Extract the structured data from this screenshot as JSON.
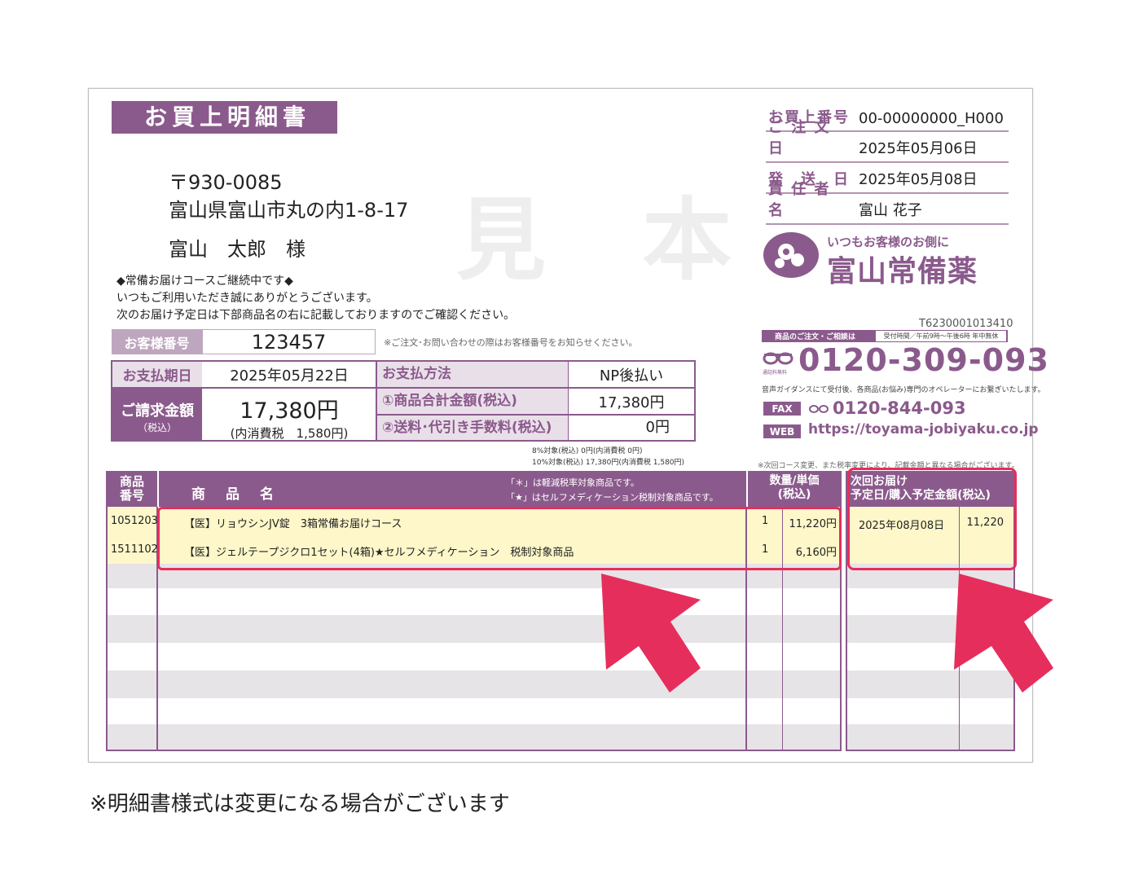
{
  "doc": {
    "title": "お買上明細書",
    "watermark": "見 本",
    "postal": "〒930-0085",
    "address": "富山県富山市丸の内1-8-17",
    "customer_name": "富山　太郎　様",
    "message_lines": [
      "◆常備お届けコースご継続中です◆",
      "いつもご利用いただき誠にありがとうございます。",
      "次のお届け予定日は下部商品名の右に記載しておりますのでご確認ください。"
    ],
    "note_bottom": "※明細書様式は変更になる場合がございます"
  },
  "header_info": [
    {
      "label": "お買上番号",
      "value": "00-00000000_H000"
    },
    {
      "label": "ご 注 文 日",
      "value": "2025年05月06日"
    },
    {
      "label": "発　送　日",
      "value": "2025年05月08日"
    },
    {
      "label": "責 任 者 名",
      "value": "富山 花子"
    }
  ],
  "brand": {
    "tagline": "いつもお客様のお側に",
    "name": "富山常備薬",
    "registration": "T6230001013410",
    "contact_label": "商品のご注文・ご相談は",
    "hours": "受付時間／午前9時〜午後6時 年中無休",
    "freedial_icon_label": "通話料無料",
    "phone": "0120-309-093",
    "guidance": "音声ガイダンスにて受付後、各商品(お悩み)専門のオペレーターにお繋ぎいたします。",
    "fax_label": "FAX",
    "fax": "0120-844-093",
    "web_label": "WEB",
    "web": "https://toyama-jobiyaku.co.jp"
  },
  "billing": {
    "customer_no_label": "お客様番号",
    "customer_no": "123457",
    "customer_no_note": "※ご注文･お問い合わせの際はお客様番号をお知らせください。",
    "due_label": "お支払期日",
    "due": "2025年05月22日",
    "method_label": "お支払方法",
    "method": "NP後払い",
    "amount_label": "ご請求金額",
    "amount_sub": "（税込）",
    "amount": "17,380円",
    "amount_tax": "(内消費税　1,580円)",
    "subtotal_label": "①商品合計金額(税込)",
    "subtotal": "17,380円",
    "fee_label": "②送料･代引き手数料(税込)",
    "fee": "0円",
    "tax_note1": "8%対象(税込) 0円(内消費税 0円)",
    "tax_note2": "10%対象(税込) 17,380円(内消費税 1,580円)",
    "next_note": "※次回コース変更、また税率変更により、記載金額と異なる場合がございます。"
  },
  "table": {
    "col_code": "商品\n番号",
    "col_name": "商　品　名",
    "col_note1": "「＊」は軽減税率対象商品です。",
    "col_note2": "「★」はセルフメディケーション税制対象商品です。",
    "col_qty": "数量/単価\n(税込)",
    "col_next": "次回お届け\n予定日/購入予定金額(税込)",
    "rows": [
      {
        "code": "1051203",
        "name": "【医】リョウシンJV錠　3箱常備お届けコース",
        "qty": "1",
        "price": "11,220円",
        "next_date": "2025年08月08日",
        "next_amount": "11,220"
      },
      {
        "code": "1511102",
        "name": "【医】ジェルテープジクロ1セット(4箱)★セルフメディケーション　税制対象商品",
        "qty": "1",
        "price": "6,160円",
        "next_date": "",
        "next_amount": ""
      }
    ]
  },
  "colors": {
    "brand_purple": "#8b5a8c",
    "highlight": "#e62e5c",
    "row_yellow": "#fdf7c9"
  }
}
